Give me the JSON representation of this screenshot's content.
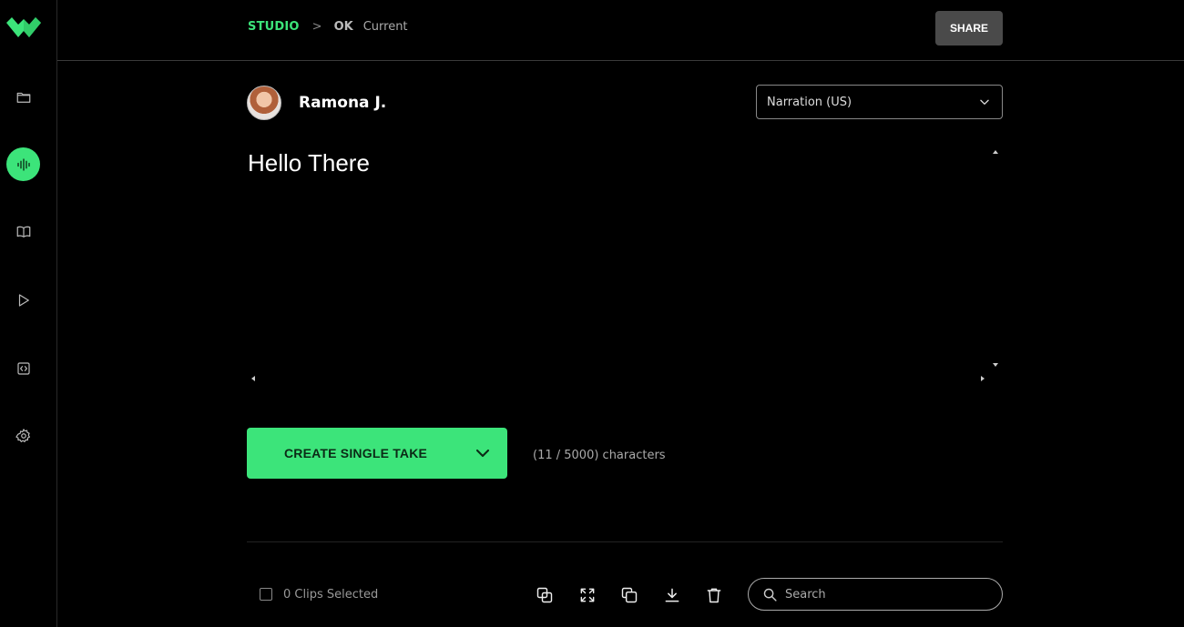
{
  "brand": {
    "accent": "#3ce47a",
    "logo_icon": "wave-logo-icon"
  },
  "sidebar": {
    "items": [
      {
        "name": "projects",
        "icon": "folder-icon",
        "active": false
      },
      {
        "name": "studio",
        "icon": "waveform-icon",
        "active": true
      },
      {
        "name": "library",
        "icon": "book-icon",
        "active": false
      },
      {
        "name": "player",
        "icon": "play-icon",
        "active": false
      },
      {
        "name": "api",
        "icon": "code-icon",
        "active": false
      },
      {
        "name": "settings",
        "icon": "gear-icon",
        "active": false
      }
    ]
  },
  "header": {
    "breadcrumb": {
      "root": "STUDIO",
      "separator": ">",
      "project": "OK",
      "status": "Current"
    },
    "share_label": "SHARE"
  },
  "voice": {
    "name": "Ramona J.",
    "style_selected": "Narration (US)"
  },
  "editor": {
    "text": "Hello There"
  },
  "actions": {
    "create_label": "CREATE SINGLE TAKE",
    "char_count": "(11 / 5000) characters"
  },
  "clips": {
    "selected_label": "0 Clips Selected",
    "tools": [
      {
        "name": "merge",
        "icon": "merge-icon"
      },
      {
        "name": "expand",
        "icon": "expand-icon"
      },
      {
        "name": "duplicate",
        "icon": "duplicate-icon"
      },
      {
        "name": "download",
        "icon": "download-icon"
      },
      {
        "name": "delete",
        "icon": "trash-icon"
      }
    ],
    "search_placeholder": "Search",
    "search_value": ""
  }
}
